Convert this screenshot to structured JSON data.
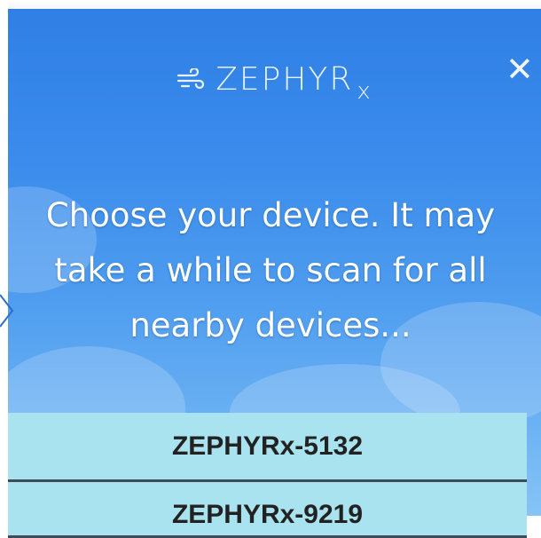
{
  "app": {
    "brand": "ZEPHYR",
    "brand_suffix": "x",
    "brand_icon": "wind-icon"
  },
  "header": {
    "close_label": "✕",
    "close_icon": "close-icon"
  },
  "instructions": {
    "text": "Choose your device. It may take a while to scan for all nearby devices..."
  },
  "devices": [
    {
      "label": "ZEPHYRx-5132"
    },
    {
      "label": "ZEPHYRx-9219"
    }
  ],
  "colors": {
    "panel_top": "#2f7fe6",
    "panel_bottom": "#86c4f5",
    "device_bg": "#a9e3f0",
    "device_divider": "#3d4d57"
  }
}
